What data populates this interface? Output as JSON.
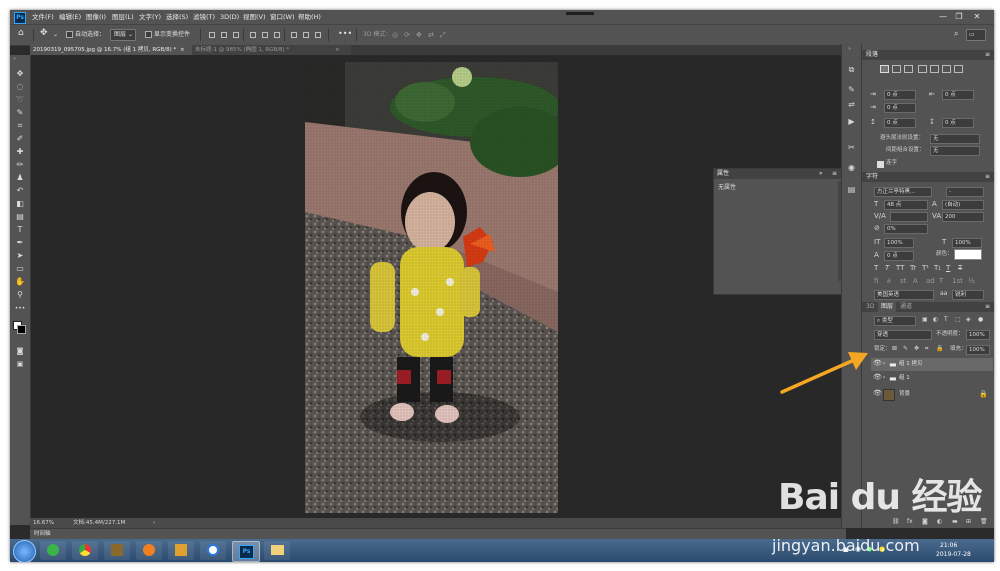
{
  "app": {
    "logo": "Ps",
    "menu": [
      "文件(F)",
      "编辑(E)",
      "图像(I)",
      "图层(L)",
      "文字(Y)",
      "选择(S)",
      "滤镜(T)",
      "3D(D)",
      "视图(V)",
      "窗口(W)",
      "帮助(H)"
    ],
    "window_buttons": [
      "—",
      "❐",
      "✕"
    ]
  },
  "options_bar": {
    "auto_select_label": "自动选择：",
    "auto_select_value": "图层",
    "show_transform_label": "显示变换控件",
    "mode_3d_label": "3D 模式："
  },
  "tabs": [
    {
      "label": "20190319_095705.jpg @ 16.7% (组 1 拷贝, RGB/8) *",
      "close": "×"
    },
    {
      "label": "未标题-1 @ 985% (椭圆 1, RGB/8) *",
      "close": "×"
    }
  ],
  "status": {
    "zoom": "16.67%",
    "doc": "文档:45.4M/227.1M",
    "arrow": "›",
    "timeline": "时间轴"
  },
  "properties": {
    "title": "属性",
    "content": "无属性"
  },
  "paragraph": {
    "title": "段落",
    "indent_left": "0 点",
    "indent_right": "0 点",
    "indent_first": "0 点",
    "space_before": "0 点",
    "space_after": "0 点",
    "kinsoku_label": "避头尾法则设置：",
    "kinsoku_value": "无",
    "mojikumi_label": "间距组合设置：",
    "mojikumi_value": "无",
    "hyphenate_label": "连字"
  },
  "character": {
    "title": "字符",
    "font_family": "方正兰亭特黑...",
    "font_style": "-",
    "font_size": "48 点",
    "leading": "(自动)",
    "kerning": "",
    "tracking": "200",
    "scale_vert_pct": "0%",
    "vert_scale": "100%",
    "horiz_scale": "100%",
    "baseline": "0 点",
    "color_label": "颜色：",
    "language": "美国英语",
    "antialias_icon": "aa",
    "antialias": "锐利"
  },
  "layers_panel": {
    "tabs": [
      "3D",
      "图层",
      "通道"
    ],
    "filter_kind": "类型",
    "blend_mode": "穿透",
    "opacity_label": "不透明度：",
    "opacity": "100%",
    "lock_label": "锁定：",
    "fill_label": "填充：",
    "fill": "100%",
    "layers": [
      {
        "name": "组 1 拷贝",
        "type": "group",
        "selected": true
      },
      {
        "name": "组 1",
        "type": "group",
        "selected": false
      },
      {
        "name": "背景",
        "type": "pixel",
        "selected": false
      }
    ]
  },
  "taskbar": {
    "clock_time": "21:06",
    "clock_date": "2019-07-28",
    "ps_label": "Ps"
  },
  "watermark": {
    "logo": "Bai du 经验",
    "url": "jingyan.baidu.com"
  },
  "colors": {
    "ps_ui": "#535353",
    "canvas_bg": "#282828",
    "arrow": "#f5a623",
    "ps_blue": "#31a8ff"
  }
}
